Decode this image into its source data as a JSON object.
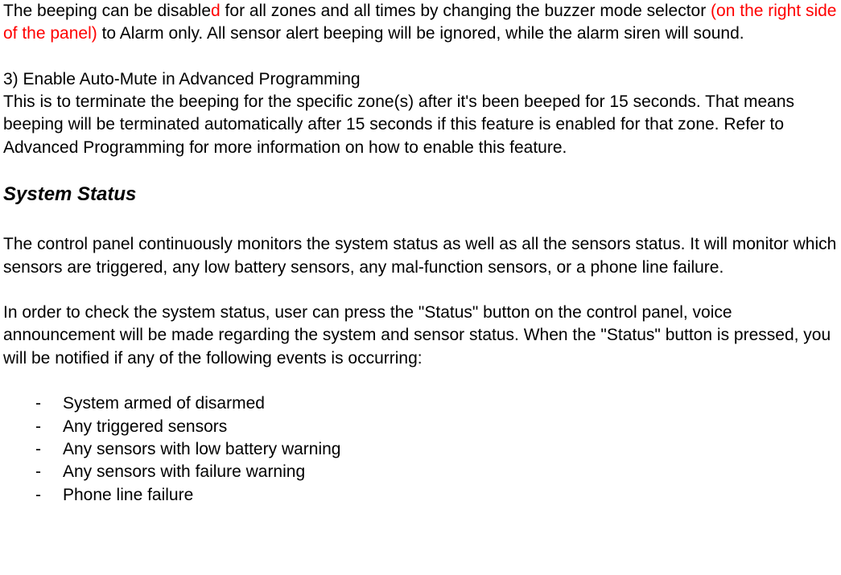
{
  "p1": {
    "part1": "The beeping can be disable",
    "red1": "d",
    "part2": " for all zones and all times by changing the buzzer mode selector ",
    "red2": "(on the right side of the panel)",
    "part3": " to Alarm only.  All sensor alert beeping will be ignored, while the alarm siren will sound."
  },
  "p2_line1": "3)  Enable Auto-Mute in Advanced Programming",
  "p2_line2": "This is to terminate the beeping for the specific zone(s) after it's been beeped for 15 seconds.  That means beeping will be terminated automatically after 15 seconds if this feature is enabled for that zone.  Refer to Advanced Programming for more information on how to enable this feature.",
  "heading": "System Status",
  "p3": "The control panel continuously monitors the system status as well as all the sensors status.  It will monitor which sensors are triggered, any low battery sensors, any mal-function sensors, or a phone line failure.",
  "p4": "In order to check the system status, user can press the \"Status\" button on the control panel, voice announcement will be made regarding the system and sensor status.  When the \"Status\" button is pressed, you will be notified if any of the following events is occurring:",
  "list": {
    "dash": "-",
    "items": [
      "System armed of disarmed",
      "Any triggered sensors",
      "Any sensors with low battery warning",
      "Any sensors with failure warning",
      "Phone line failure"
    ]
  }
}
